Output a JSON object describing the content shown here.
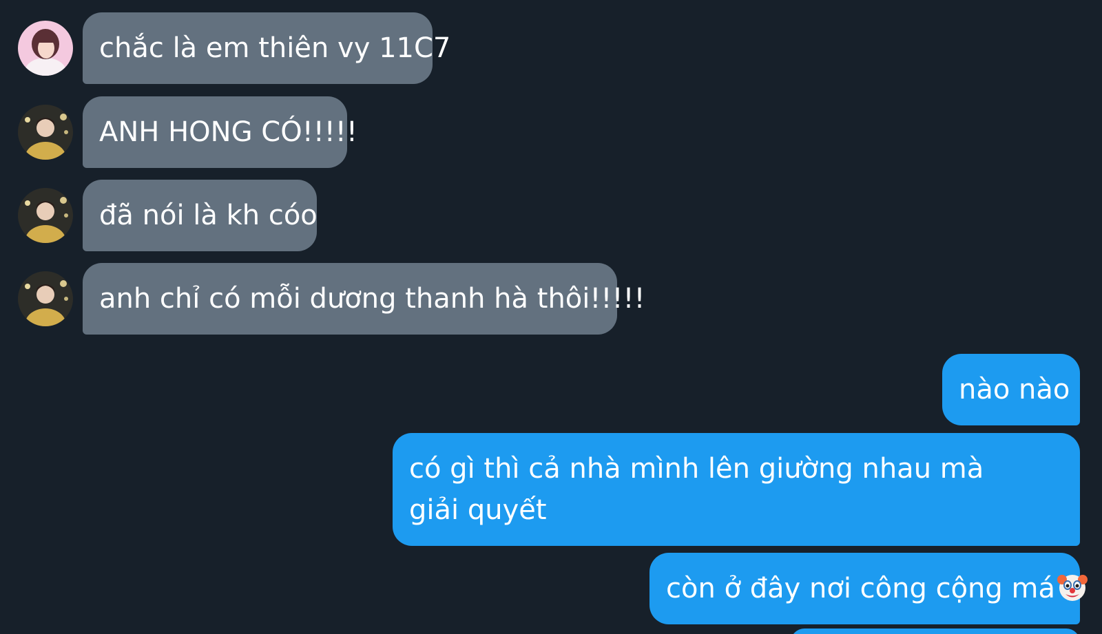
{
  "conversation": {
    "messages": [
      {
        "sender": "other",
        "avatar": "girl-avatar",
        "text": "chắc là em thiên vy 11C7"
      },
      {
        "sender": "other",
        "avatar": "boy-avatar",
        "text": "ANH HONG CÓ!!!!!"
      },
      {
        "sender": "other",
        "avatar": "boy-avatar",
        "text": "đã nói là kh cóo"
      },
      {
        "sender": "other",
        "avatar": "boy-avatar",
        "text": "anh chỉ có mỗi dương thanh hà thôi!!!!!"
      },
      {
        "sender": "me",
        "text": "nào nào"
      },
      {
        "sender": "me",
        "text": "có gì thì cả nhà mình lên giường nhau mà giải quyết"
      },
      {
        "sender": "me",
        "text": "còn ở đây nơi công cộng má",
        "emoji": "clown-face-icon"
      }
    ]
  },
  "colors": {
    "background": "#17202a",
    "incoming_bubble": "#63717f",
    "outgoing_bubble": "#1d9bf0",
    "text": "#ffffff"
  }
}
